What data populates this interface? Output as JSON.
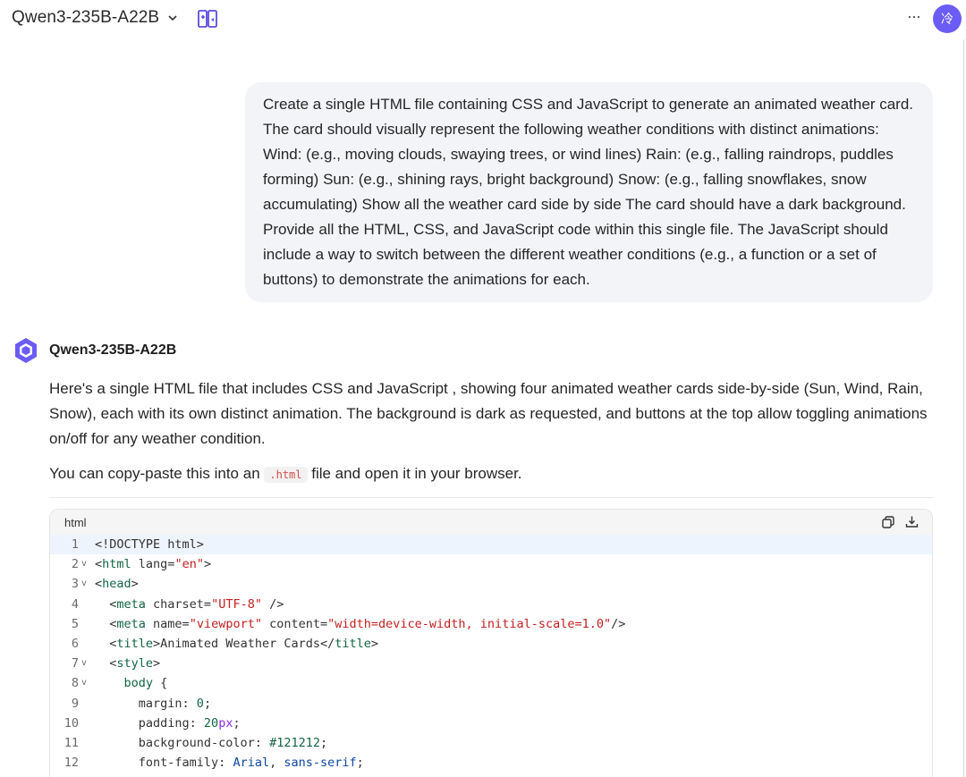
{
  "header": {
    "model_name": "Qwen3-235B-A22B",
    "more_label": "···",
    "avatar_label": "冷"
  },
  "user_message": {
    "text": "Create a single HTML file containing CSS and JavaScript to generate an animated weather card. The card should visually represent the following weather conditions with distinct animations: Wind: (e.g., moving clouds, swaying trees, or wind lines) Rain: (e.g., falling raindrops, puddles forming) Sun: (e.g., shining rays, bright background) Snow: (e.g., falling snowflakes, snow accumulating) Show all the weather card side by side The card should have a dark background. Provide all the HTML, CSS, and JavaScript code within this single file. The JavaScript should include a way to switch between the different weather conditions (e.g., a function or a set of buttons) to demonstrate the animations for each."
  },
  "assistant": {
    "name": "Qwen3-235B-A22B",
    "paragraph1": "Here's a single HTML file that includes CSS and JavaScript , showing four animated weather cards side-by-side (Sun, Wind, Rain, Snow), each with its own distinct animation. The background is dark as requested, and buttons at the top allow toggling animations on/off for any weather condition.",
    "paragraph2_before": "You can copy-paste this into an ",
    "paragraph2_code": ".html",
    "paragraph2_after": " file and open it in your browser."
  },
  "code_block": {
    "language": "html",
    "line_numbers": [
      "1",
      "2",
      "3",
      "4",
      "5",
      "6",
      "7",
      "8",
      "9",
      "10",
      "11",
      "12"
    ],
    "fold_markers": [
      "",
      "v",
      "v",
      "",
      "",
      "",
      "v",
      "v",
      "",
      "",
      "",
      ""
    ]
  },
  "colors": {
    "accent": "#6b5cf6",
    "bubble_bg": "#f3f4f8",
    "code_header_bg": "#f5f5f5",
    "active_line_bg": "#eef4fd"
  }
}
